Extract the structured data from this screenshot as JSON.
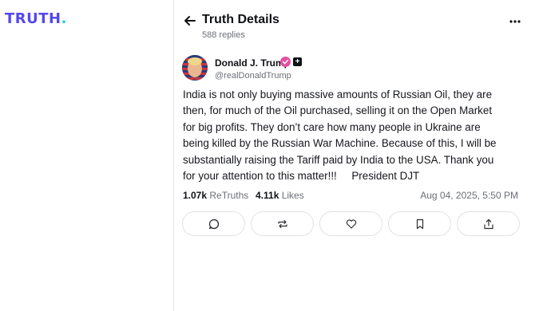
{
  "brand": {
    "logo_text": "TRUTH",
    "logo_dot": ".",
    "accent": "#5448ee",
    "dot_color": "#17d1c6"
  },
  "header": {
    "title": "Truth Details",
    "replies": "588 replies",
    "back_icon": "arrow-left-icon",
    "more_icon": "more-horizontal-icon"
  },
  "post": {
    "author_name": "Donald J. Trump",
    "handle": "@realDonaldTrump",
    "verified_icon": "verified-badge-icon",
    "verified_color": "#e64fa0",
    "text": "India is not only buying massive amounts of Russian Oil, they are\nthen, for much of the Oil purchased, selling it on the Open Market\nfor big profits. They don’t care how many people in Ukraine are\nbeing killed by the Russian War Machine. Because of this, I will be\nsubstantially raising the Tariff paid by India to the USA. Thank you\nfor your attention to this matter!!!     President DJT",
    "retruths_count": "1.07k",
    "retruths_label": "ReTruths",
    "likes_count": "4.11k",
    "likes_label": "Likes",
    "date": "Aug 04, 2025, 5:50 PM"
  },
  "actions": [
    {
      "icon": "reply-icon"
    },
    {
      "icon": "retruth-icon"
    },
    {
      "icon": "heart-icon"
    },
    {
      "icon": "bookmark-icon"
    },
    {
      "icon": "share-icon"
    }
  ]
}
